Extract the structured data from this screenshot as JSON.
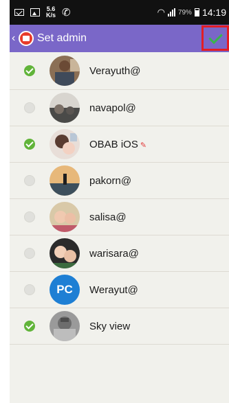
{
  "status_bar": {
    "speed_top": "5.6",
    "speed_bottom": "K/s",
    "battery_percent": "79%",
    "time": "14:19"
  },
  "action_bar": {
    "title": "Set admin",
    "back_glyph": "‹"
  },
  "members": [
    {
      "name": "Verayuth@",
      "selected": true,
      "avatar": "photo"
    },
    {
      "name": "navapol@",
      "selected": false,
      "avatar": "photo"
    },
    {
      "name": "OBAB iOS",
      "selected": true,
      "avatar": "photo",
      "pinned": true
    },
    {
      "name": "pakorn@",
      "selected": false,
      "avatar": "photo"
    },
    {
      "name": "salisa@",
      "selected": false,
      "avatar": "photo"
    },
    {
      "name": "warisara@",
      "selected": false,
      "avatar": "photo"
    },
    {
      "name": "Werayut@",
      "selected": false,
      "avatar": "PC"
    },
    {
      "name": "Sky view",
      "selected": true,
      "avatar": "photo"
    }
  ],
  "colors": {
    "action_bar": "#7a67c8",
    "checked": "#61b43a",
    "confirm_highlight": "#e31d24"
  }
}
